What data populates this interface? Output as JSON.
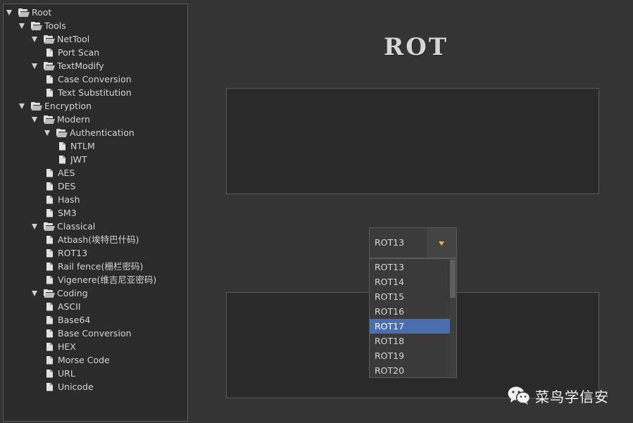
{
  "tree": [
    {
      "label": "Root",
      "type": "folder",
      "depth": 0,
      "expanded": true
    },
    {
      "label": "Tools",
      "type": "folder",
      "depth": 1,
      "expanded": true
    },
    {
      "label": "NetTool",
      "type": "folder",
      "depth": 2,
      "expanded": true
    },
    {
      "label": "Port Scan",
      "type": "file",
      "depth": 3
    },
    {
      "label": "TextModify",
      "type": "folder",
      "depth": 2,
      "expanded": true
    },
    {
      "label": "Case Conversion",
      "type": "file",
      "depth": 3
    },
    {
      "label": "Text Substitution",
      "type": "file",
      "depth": 3
    },
    {
      "label": "Encryption",
      "type": "folder",
      "depth": 1,
      "expanded": true
    },
    {
      "label": "Modern",
      "type": "folder",
      "depth": 2,
      "expanded": true
    },
    {
      "label": "Authentication",
      "type": "folder",
      "depth": 3,
      "expanded": true
    },
    {
      "label": "NTLM",
      "type": "file",
      "depth": 4
    },
    {
      "label": "JWT",
      "type": "file",
      "depth": 4
    },
    {
      "label": "AES",
      "type": "file",
      "depth": 3
    },
    {
      "label": "DES",
      "type": "file",
      "depth": 3
    },
    {
      "label": "Hash",
      "type": "file",
      "depth": 3
    },
    {
      "label": "SM3",
      "type": "file",
      "depth": 3
    },
    {
      "label": "Classical",
      "type": "folder",
      "depth": 2,
      "expanded": true
    },
    {
      "label": "Atbash(埃特巴什码)",
      "type": "file",
      "depth": 3
    },
    {
      "label": "ROT13",
      "type": "file",
      "depth": 3
    },
    {
      "label": "Rail fence(栅栏密码)",
      "type": "file",
      "depth": 3
    },
    {
      "label": "Vigenere(维吉尼亚密码)",
      "type": "file",
      "depth": 3
    },
    {
      "label": "Coding",
      "type": "folder",
      "depth": 2,
      "expanded": true
    },
    {
      "label": "ASCII",
      "type": "file",
      "depth": 3
    },
    {
      "label": "Base64",
      "type": "file",
      "depth": 3
    },
    {
      "label": "Base Conversion",
      "type": "file",
      "depth": 3
    },
    {
      "label": "HEX",
      "type": "file",
      "depth": 3
    },
    {
      "label": "Morse Code",
      "type": "file",
      "depth": 3
    },
    {
      "label": "URL",
      "type": "file",
      "depth": 3
    },
    {
      "label": "Unicode",
      "type": "file",
      "depth": 3
    }
  ],
  "main": {
    "title": "ROT",
    "input_text": "",
    "output_text": ""
  },
  "rot_select": {
    "value": "ROT13",
    "options": [
      "ROT13",
      "ROT14",
      "ROT15",
      "ROT16",
      "ROT17",
      "ROT18",
      "ROT19",
      "ROT20"
    ],
    "highlighted": "ROT17"
  },
  "watermark": {
    "text": "菜鸟学信安",
    "icon": "wechat-icon"
  },
  "colors": {
    "background": "#343434",
    "panel": "#2b2b2b",
    "highlight": "#4b6eaf",
    "dropdown_arrow": "#e8b83a"
  }
}
